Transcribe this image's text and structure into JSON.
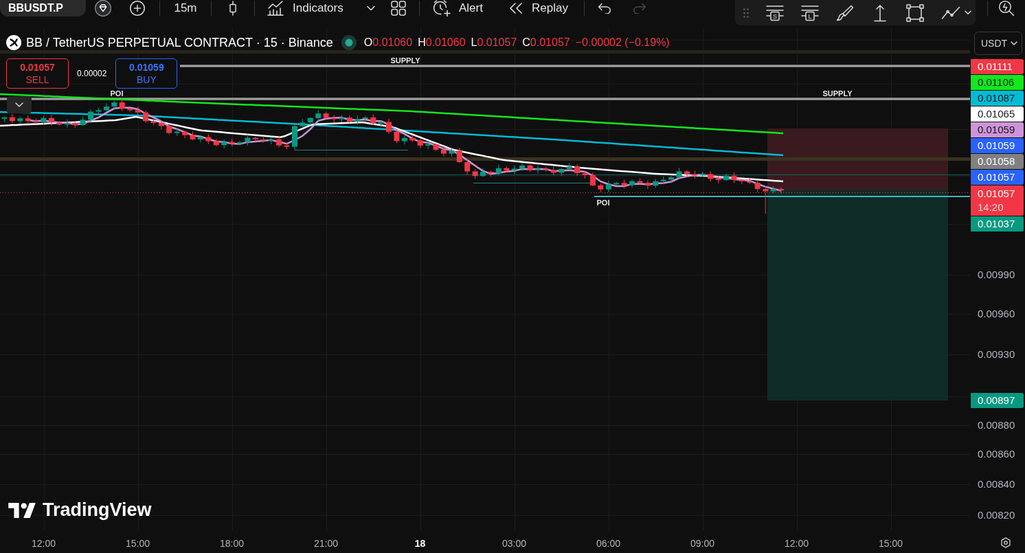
{
  "toolbar": {
    "symbol": "BBUSDT.P",
    "interval": "15m",
    "indicators": "Indicators",
    "alert": "Alert",
    "replay": "Replay",
    "history": [
      {
        "kind": "undo",
        "disabled": false
      },
      {
        "kind": "redo",
        "disabled": true
      }
    ]
  },
  "drawing_toolbar": {
    "tools": [
      {
        "kind": "lines",
        "letter": "S"
      },
      {
        "kind": "lines",
        "letter": "L"
      },
      {
        "kind": "brush"
      },
      {
        "kind": "anchor"
      },
      {
        "kind": "rectangle"
      },
      {
        "kind": "trend"
      }
    ]
  },
  "legend": {
    "title": "BB / TetherUS PERPETUAL CONTRACT · 15 · Binance",
    "negative": true,
    "ohlc": [
      {
        "key": "O",
        "value": "0.01060"
      },
      {
        "key": "H",
        "value": "0.01060"
      },
      {
        "key": "L",
        "value": "0.01057"
      },
      {
        "key": "C",
        "value": "0.01057"
      }
    ],
    "change": "−0.00002 (−0.19%)"
  },
  "trade": {
    "sell": {
      "price": "0.01057",
      "label": "SELL"
    },
    "spread": "0.00002",
    "buy": {
      "price": "0.01059",
      "label": "BUY"
    }
  },
  "chart": {
    "zones": [
      {
        "kind": "supply",
        "label": "SUPPLY"
      },
      {
        "kind": "supply",
        "label": "SUPPLY"
      }
    ],
    "poi_labels": [
      "POI",
      "POI"
    ],
    "logo": "TradingView"
  },
  "price_axis": {
    "currency": "USDT",
    "tags": [
      {
        "value": "0.01111",
        "color": "#f23645"
      },
      {
        "value": "0.01106",
        "color": "#12e81c"
      },
      {
        "value": "0.01087",
        "color": "#00bcd4"
      },
      {
        "value": "0.01065",
        "color": "#ffffff"
      },
      {
        "value": "0.01059",
        "color": "#ce93d8"
      },
      {
        "value": "0.01059",
        "color": "#2962ff"
      },
      {
        "value": "0.01058",
        "color": "#808080"
      },
      {
        "value": "0.01057",
        "color": "#2962ff"
      },
      {
        "value": "0.01057",
        "color": "#f23645",
        "countdown": "14:20"
      },
      {
        "value": "0.01037",
        "color": "#089981"
      }
    ],
    "scale_labels": [
      {
        "kind": "tick",
        "value": "0.00990"
      },
      {
        "kind": "tick",
        "value": "0.00960"
      },
      {
        "kind": "tick",
        "value": "0.00930"
      },
      {
        "kind": "tag",
        "value": "0.00897",
        "color": "#089981"
      },
      {
        "kind": "tick",
        "value": "0.00880"
      },
      {
        "kind": "tick",
        "value": "0.00860"
      },
      {
        "kind": "tick",
        "value": "0.00840"
      },
      {
        "kind": "tick",
        "value": "0.00820"
      }
    ]
  },
  "time_axis": {
    "labels": [
      {
        "kind": "time",
        "text": "12:00"
      },
      {
        "kind": "time",
        "text": "15:00"
      },
      {
        "kind": "time",
        "text": "18:00"
      },
      {
        "kind": "time",
        "text": "21:00"
      },
      {
        "kind": "day",
        "text": "18"
      },
      {
        "kind": "time",
        "text": "03:00"
      },
      {
        "kind": "time",
        "text": "06:00"
      },
      {
        "kind": "time",
        "text": "09:00"
      },
      {
        "kind": "time",
        "text": "12:00"
      },
      {
        "kind": "time",
        "text": "15:00"
      }
    ]
  }
}
